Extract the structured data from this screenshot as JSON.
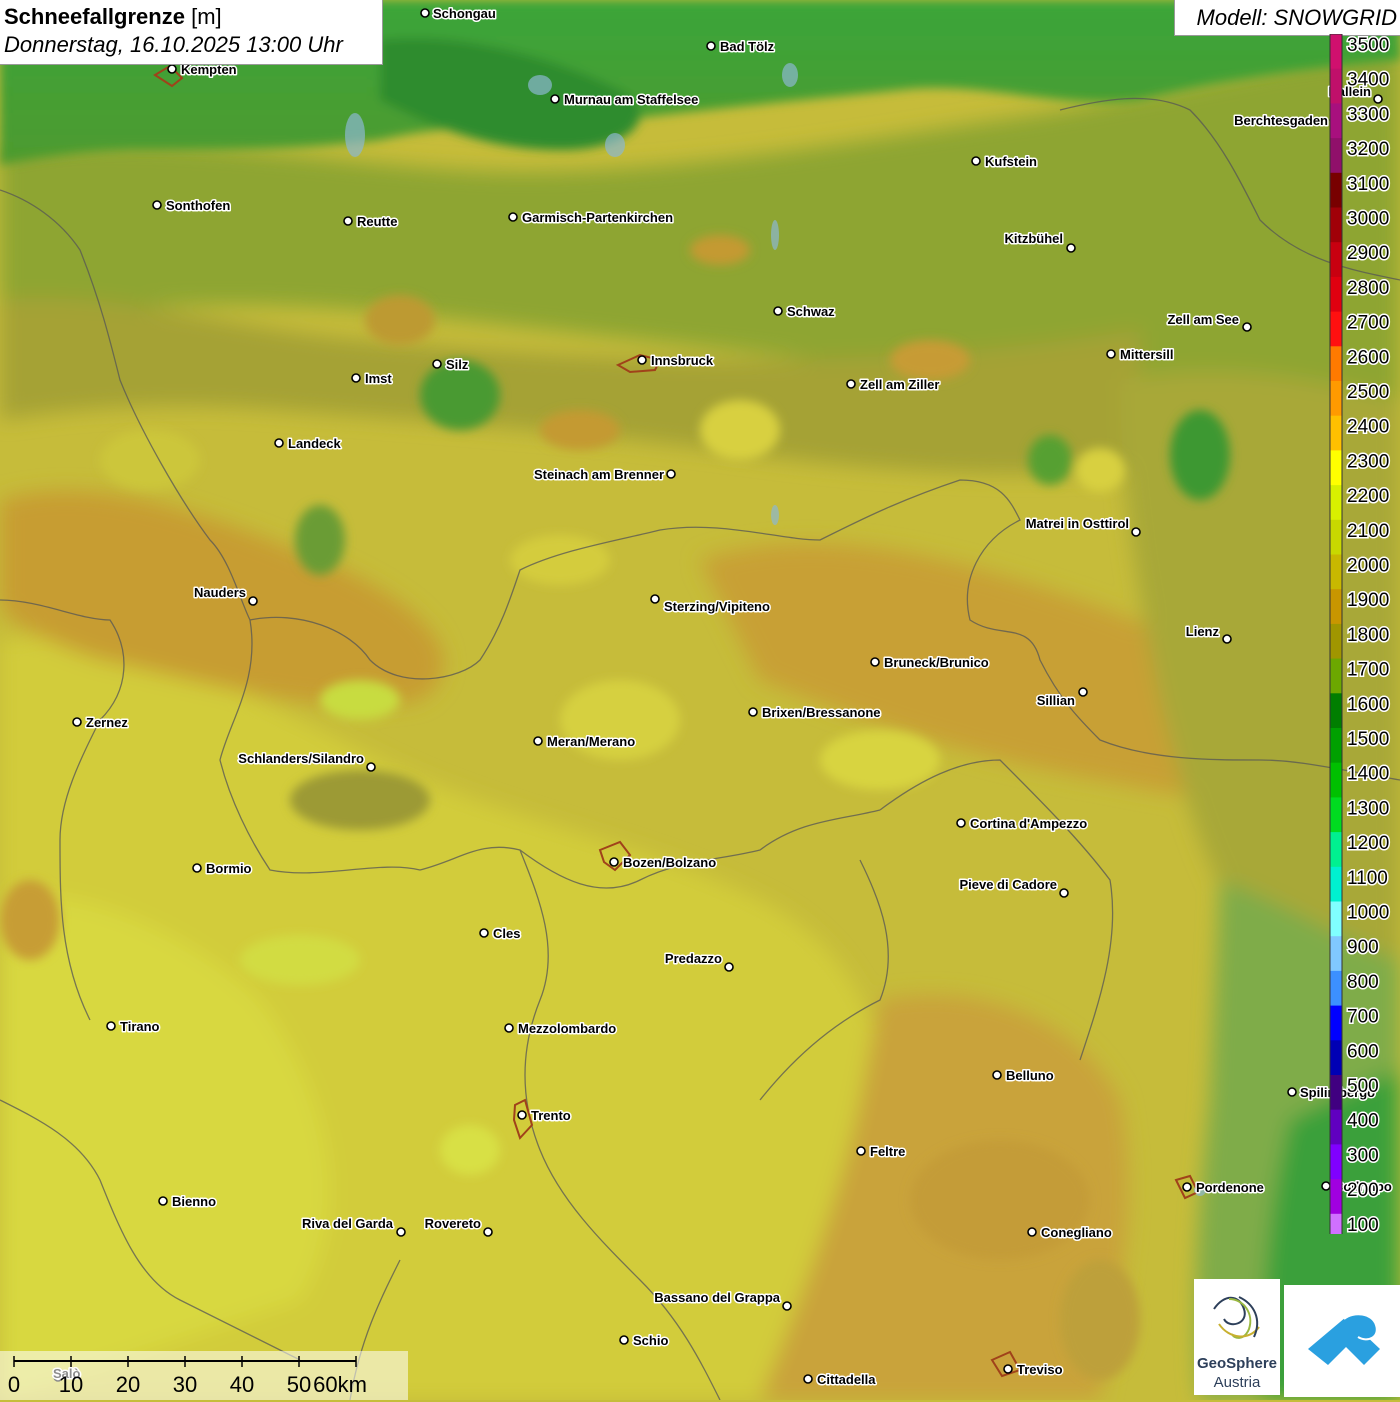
{
  "header": {
    "title": "Schneefallgrenze",
    "unit": "[m]",
    "datetime": "Donnerstag, 16.10.2025 13:00 Uhr"
  },
  "model": {
    "label": "Modell: SNOWGRID"
  },
  "legend": {
    "ticks": [
      "3500",
      "3400",
      "3300",
      "3200",
      "3100",
      "3000",
      "2900",
      "2800",
      "2700",
      "2600",
      "2500",
      "2400",
      "2300",
      "2200",
      "2100",
      "2000",
      "1900",
      "1800",
      "1700",
      "1600",
      "1500",
      "1400",
      "1300",
      "1200",
      "1100",
      "1000",
      "900",
      "800",
      "700",
      "600",
      "500",
      "400",
      "300",
      "200",
      "100"
    ],
    "colors": [
      "#d0106e",
      "#c0106a",
      "#a8107e",
      "#90106a",
      "#780000",
      "#a00008",
      "#c80010",
      "#e00010",
      "#ff1010",
      "#ff7a00",
      "#ff9a00",
      "#ffc000",
      "#ffff00",
      "#d8f000",
      "#c8d800",
      "#c8b800",
      "#c89600",
      "#a09600",
      "#6ca800",
      "#007e00",
      "#00a000",
      "#00c000",
      "#00dc20",
      "#00f090",
      "#00f0d0",
      "#80ffff",
      "#80c8ff",
      "#3c90ff",
      "#0000ff",
      "#0000b4",
      "#400080",
      "#6000c0",
      "#8000ff",
      "#a000e0",
      "#d070ff"
    ]
  },
  "cities": [
    {
      "name": "Schongau"
    },
    {
      "name": "Bad Tölz"
    },
    {
      "name": "Kempten"
    },
    {
      "name": "Murnau am Staffelsee"
    },
    {
      "name": "Hallein"
    },
    {
      "name": "Berchtesgaden"
    },
    {
      "name": "Kufstein"
    },
    {
      "name": "Sonthofen"
    },
    {
      "name": "Reutte"
    },
    {
      "name": "Garmisch-Partenkirchen"
    },
    {
      "name": "Kitzbühel"
    },
    {
      "name": "Schwaz"
    },
    {
      "name": "Zell am See"
    },
    {
      "name": "Innsbruck"
    },
    {
      "name": "Mittersill"
    },
    {
      "name": "Silz"
    },
    {
      "name": "Imst"
    },
    {
      "name": "Zell am Ziller"
    },
    {
      "name": "Landeck"
    },
    {
      "name": "Steinach am Brenner"
    },
    {
      "name": "Matrei in Osttirol"
    },
    {
      "name": "Nauders"
    },
    {
      "name": "Sterzing/Vipiteno"
    },
    {
      "name": "Lienz"
    },
    {
      "name": "Bruneck/Brunico"
    },
    {
      "name": "Sillian"
    },
    {
      "name": "Zernez"
    },
    {
      "name": "Brixen/Bressanone"
    },
    {
      "name": "Meran/Merano"
    },
    {
      "name": "Schlanders/Silandro"
    },
    {
      "name": "Cortina d'Ampezzo"
    },
    {
      "name": "Bozen/Bolzano"
    },
    {
      "name": "Bormio"
    },
    {
      "name": "Pieve di Cadore"
    },
    {
      "name": "Cles"
    },
    {
      "name": "Predazzo"
    },
    {
      "name": "Tirano"
    },
    {
      "name": "Mezzolombardo"
    },
    {
      "name": "Belluno"
    },
    {
      "name": "Spilimbergo"
    },
    {
      "name": "Trento"
    },
    {
      "name": "Feltre"
    },
    {
      "name": "Pordenone"
    },
    {
      "name": "Codroipo"
    },
    {
      "name": "Bienno"
    },
    {
      "name": "Riva del Garda"
    },
    {
      "name": "Rovereto"
    },
    {
      "name": "Conegliano"
    },
    {
      "name": "Bassano del Grappa"
    },
    {
      "name": "Schio"
    },
    {
      "name": "Treviso"
    },
    {
      "name": "Cittadella"
    },
    {
      "name": "Salò"
    }
  ],
  "scalebar": {
    "labels": [
      "0",
      "10",
      "20",
      "30",
      "40",
      "50",
      "60km"
    ]
  },
  "logos": {
    "geosphere_line1": "GeoSphere",
    "geosphere_line2": "Austria"
  }
}
